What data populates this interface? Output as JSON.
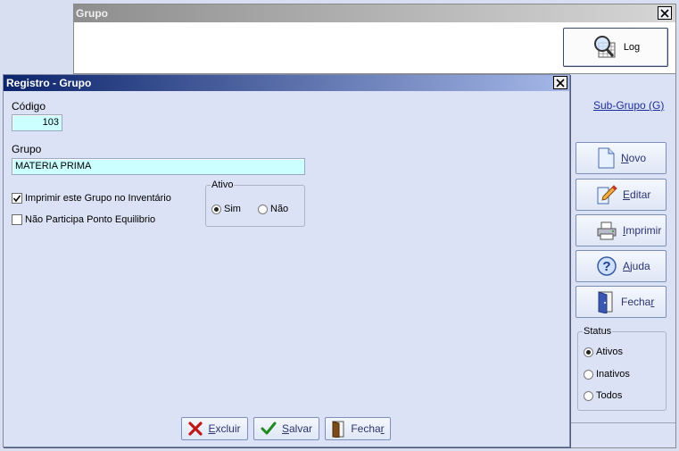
{
  "back_window": {
    "title": "Grupo",
    "log_button": {
      "label": "Log",
      "icon": "magnifier-grid-icon"
    },
    "subgrupo_link": "Sub-Grupo (G)",
    "side_buttons": [
      {
        "first": "N",
        "rest": "ovo",
        "icon": "new-document-icon"
      },
      {
        "first": "E",
        "rest": "ditar",
        "icon": "edit-pencil-icon"
      },
      {
        "first": "I",
        "rest": "mprimir",
        "icon": "printer-icon"
      },
      {
        "first": "A",
        "rest": "juda",
        "icon": "help-question-icon"
      },
      {
        "prefix": "Fecha",
        "underlined": "r",
        "icon": "exit-door-icon"
      }
    ],
    "status": {
      "legend": "Status",
      "options": [
        "Ativos",
        "Inativos",
        "Todos"
      ],
      "selected": "Ativos"
    }
  },
  "dialog": {
    "title": "Registro - Grupo",
    "codigo_label": "Código",
    "codigo_value": "103",
    "grupo_label": "Grupo",
    "grupo_value": "MATERIA PRIMA",
    "checkbox_inventario": {
      "label": "Imprimir este Grupo no Inventário",
      "checked": true
    },
    "checkbox_equilibrio": {
      "label": "Não Participa Ponto Equilibrio",
      "checked": false
    },
    "ativo": {
      "legend": "Ativo",
      "options": [
        "Sim",
        "Não"
      ],
      "selected": "Sim"
    },
    "buttons": {
      "excluir": {
        "first": "E",
        "rest": "xcluir"
      },
      "salvar": {
        "first": "S",
        "rest": "alvar"
      },
      "fechar": {
        "prefix": "Fecha",
        "underlined": "r"
      }
    }
  },
  "colors": {
    "title_active_start": "#0c246b",
    "title_active_end": "#a6b8e8",
    "input_bg": "#ccffff",
    "window_bg": "#dbe2f5",
    "link": "#1c2e9c"
  }
}
